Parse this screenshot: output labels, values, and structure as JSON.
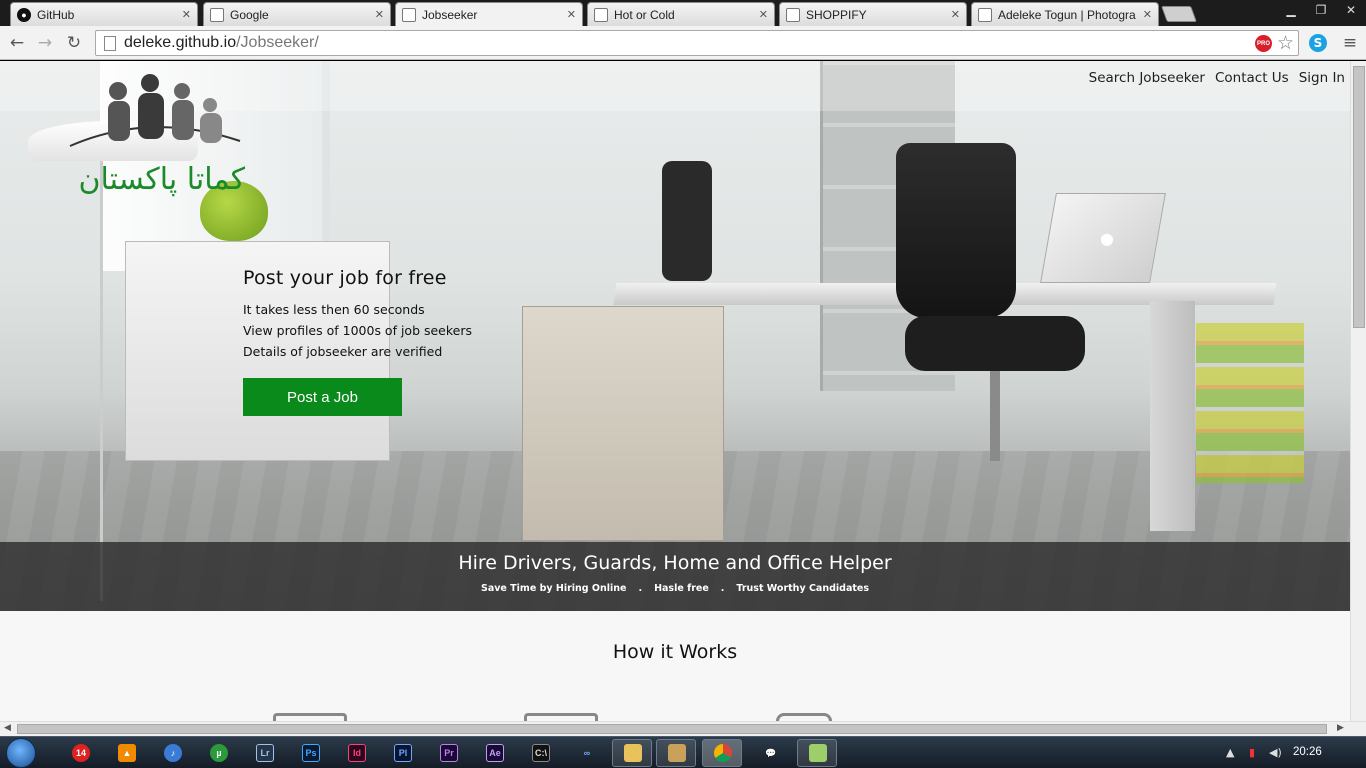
{
  "browser": {
    "tabs": [
      {
        "title": "GitHub",
        "favicon": "github-icon"
      },
      {
        "title": "Google",
        "favicon": "page-icon"
      },
      {
        "title": "Jobseeker",
        "favicon": "page-icon",
        "active": true
      },
      {
        "title": "Hot or Cold",
        "favicon": "page-icon"
      },
      {
        "title": "SHOPPIFY",
        "favicon": "page-icon"
      },
      {
        "title": "Adeleke Togun | Photogra",
        "favicon": "page-icon"
      }
    ],
    "close_glyph": "✕",
    "url_host": "deleke.github.io",
    "url_path": "/Jobseeker/",
    "pro_badge": "PRO",
    "skype_badge": "S"
  },
  "page": {
    "nav": {
      "search": "Search Jobseeker",
      "contact": "Contact Us",
      "signin": "Sign In"
    },
    "logo_text": "کماتا پاکستان",
    "hero": {
      "heading": "Post your job for free",
      "line1": "It takes less then 60 seconds",
      "line2": "View profiles of 1000s of job seekers",
      "line3": "Details of jobseeker are verified",
      "button": "Post a Job",
      "button_color": "#0a8a1a"
    },
    "banner": {
      "title": "Hire Drivers, Guards, Home and Office Helper",
      "tag1": "Save Time by Hiring Online",
      "tag2": "Hasle free",
      "tag3": "Trust Worthy Candidates",
      "separator": "."
    },
    "how_it_works": {
      "title": "How it Works"
    }
  },
  "taskbar": {
    "badge_count": "14",
    "apps": [
      "Lr",
      "Ps",
      "Id",
      "Pl",
      "Pr",
      "Ae"
    ],
    "clock": "20:26"
  }
}
